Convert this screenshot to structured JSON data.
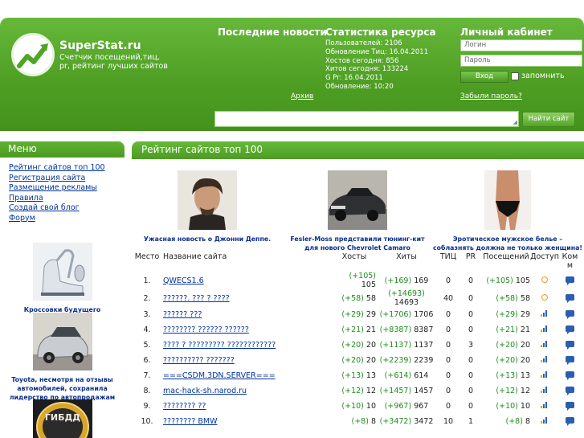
{
  "header": {
    "brand": "SuperStat.ru",
    "tagline": "Счетчик посещений,тиц, pr, рейтинг лучших сайтов",
    "news_title": "Последние новости",
    "archive_link": "Архив",
    "stats_title": "Статистика ресурса",
    "stats": [
      "Пользователей: 2106",
      "Обновление Тиц: 16.04.2011",
      "Хостов сегодня: 856",
      "Хитов сегодня: 133224",
      "G Pr: 16.04.2011",
      "Обновление: 10:20"
    ],
    "cabinet_title": "Личный кабинет",
    "login_placeholder": "Логин",
    "password_placeholder": "Пароль",
    "login_button": "Вход",
    "remember_label": "запомнить",
    "forgot_link": "Забыли пароль?",
    "search_button": "Найти сайт",
    "accent_color": "#4f9f24"
  },
  "sidebar": {
    "menu_title": "Меню",
    "menu_items": [
      "Рейтинг сайтов топ 100",
      "Регистрация сайта",
      "Размещение рекламы",
      "Правила",
      "Создай свой блог",
      "Форум"
    ],
    "news": [
      {
        "caption": "Кроссовки будущего",
        "image": "sneakers-photo"
      },
      {
        "caption": "Toyota, несмотря на отзывы автомобилей, сохранила лидерство по автопродажам",
        "image": "toyota-car-photo"
      },
      {
        "caption": "",
        "image": "gibdd-badge-photo",
        "badge_text": "ГИБДД"
      }
    ]
  },
  "rating": {
    "title": "Рейтинг сайтов топ 100",
    "features": [
      {
        "caption": "Ужасная новость о Джонни Деппе.",
        "image": "johnny-depp-photo"
      },
      {
        "caption": "Fesler-Moss представили тюнинг-кит для нового Chevrolet Camaro",
        "image": "camaro-photo"
      },
      {
        "caption": "Эротическое мужское белье – соблазнять должна не только женщина!",
        "image": "underwear-photo"
      }
    ],
    "columns": [
      "Место",
      "Название сайта",
      "Хосты",
      "Хиты",
      "ТИЦ",
      "PR",
      "Посещений",
      "Доступ",
      "Ком м"
    ],
    "rows": [
      {
        "place": "1.",
        "name": "QWECS1.6",
        "hosts_delta": "(+105)",
        "hosts": "105",
        "hits_delta": "(+169)",
        "hits": "169",
        "tic": "0",
        "pr": "0",
        "visits_delta": "(+105)",
        "visits": "105",
        "access": "clock"
      },
      {
        "place": "2.",
        "name": "??????. ??? ? ????",
        "hosts_delta": "(+58)",
        "hosts": "58",
        "hits_delta": "(+14693)",
        "hits": "14693",
        "tic": "40",
        "pr": "0",
        "visits_delta": "(+58)",
        "visits": "58",
        "access": "clock"
      },
      {
        "place": "3.",
        "name": "?????? ???",
        "hosts_delta": "(+29)",
        "hosts": "29",
        "hits_delta": "(+1706)",
        "hits": "1706",
        "tic": "0",
        "pr": "0",
        "visits_delta": "(+29)",
        "visits": "29",
        "access": "bars"
      },
      {
        "place": "4.",
        "name": "???????? ?????? ??????",
        "hosts_delta": "(+21)",
        "hosts": "21",
        "hits_delta": "(+8387)",
        "hits": "8387",
        "tic": "0",
        "pr": "0",
        "visits_delta": "(+21)",
        "visits": "21",
        "access": "bars"
      },
      {
        "place": "5.",
        "name": "???? ? ????????? ????????????",
        "hosts_delta": "(+20)",
        "hosts": "20",
        "hits_delta": "(+1137)",
        "hits": "1137",
        "tic": "0",
        "pr": "3",
        "visits_delta": "(+20)",
        "visits": "20",
        "access": "bars"
      },
      {
        "place": "6.",
        "name": "?????????? ???????",
        "hosts_delta": "(+20)",
        "hosts": "20",
        "hits_delta": "(+2239)",
        "hits": "2239",
        "tic": "0",
        "pr": "0",
        "visits_delta": "(+20)",
        "visits": "20",
        "access": "bars"
      },
      {
        "place": "7.",
        "name": "===CSDM.3DN.SERVER===",
        "hosts_delta": "(+13)",
        "hosts": "13",
        "hits_delta": "(+614)",
        "hits": "614",
        "tic": "0",
        "pr": "0",
        "visits_delta": "(+13)",
        "visits": "13",
        "access": "bars"
      },
      {
        "place": "8.",
        "name": "mac-hack-sh.narod.ru",
        "hosts_delta": "(+12)",
        "hosts": "12",
        "hits_delta": "(+1457)",
        "hits": "1457",
        "tic": "0",
        "pr": "0",
        "visits_delta": "(+12)",
        "visits": "12",
        "access": "bars"
      },
      {
        "place": "9.",
        "name": "???????? ??",
        "hosts_delta": "(+10)",
        "hosts": "10",
        "hits_delta": "(+967)",
        "hits": "967",
        "tic": "0",
        "pr": "0",
        "visits_delta": "(+10)",
        "visits": "10",
        "access": "bars"
      },
      {
        "place": "10.",
        "name": "???????? BMW",
        "hosts_delta": "(+8)",
        "hosts": "8",
        "hits_delta": "(+3472)",
        "hits": "3472",
        "tic": "10",
        "pr": "1",
        "visits_delta": "(+8)",
        "visits": "8",
        "access": "bars"
      }
    ]
  }
}
